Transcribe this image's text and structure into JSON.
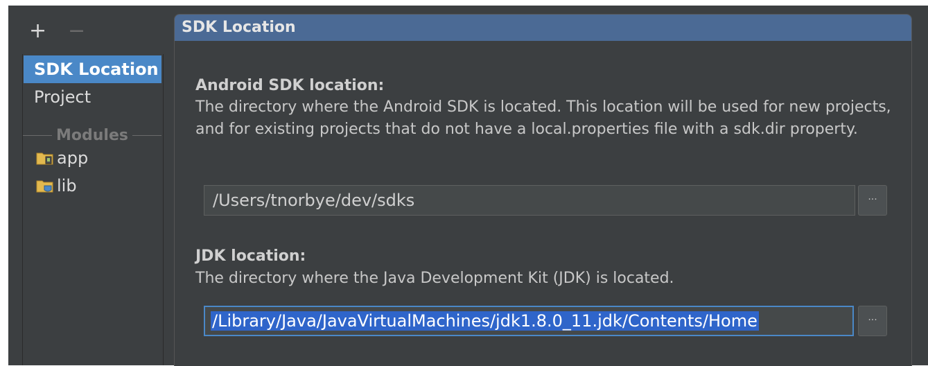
{
  "toolbar": {
    "add_label": "+",
    "remove_label": "−"
  },
  "sidebar": {
    "items": [
      {
        "label": "SDK Location",
        "selected": true
      },
      {
        "label": "Project",
        "selected": false
      }
    ],
    "modules_header": "Modules",
    "modules": [
      {
        "label": "app",
        "icon": "android-module-folder-icon"
      },
      {
        "label": "lib",
        "icon": "library-module-folder-icon"
      }
    ]
  },
  "panel": {
    "title": "SDK Location",
    "android_sdk": {
      "title": "Android SDK location:",
      "description": "The directory where the Android SDK is located. This location will be used for new projects, and for existing projects that do not have a local.properties file with a sdk.dir property.",
      "path": "/Users/tnorbye/dev/sdks",
      "browse_label": "···"
    },
    "jdk": {
      "title": "JDK location:",
      "description": "The directory where the Java Development Kit (JDK) is located.",
      "path": "/Library/Java/JavaVirtualMachines/jdk1.8.0_11.jdk/Contents/Home",
      "browse_label": "···"
    }
  },
  "colors": {
    "background": "#3c3f41",
    "selection": "#4a88c7",
    "header": "#4b6a95",
    "text_selection": "#2f65ca"
  }
}
